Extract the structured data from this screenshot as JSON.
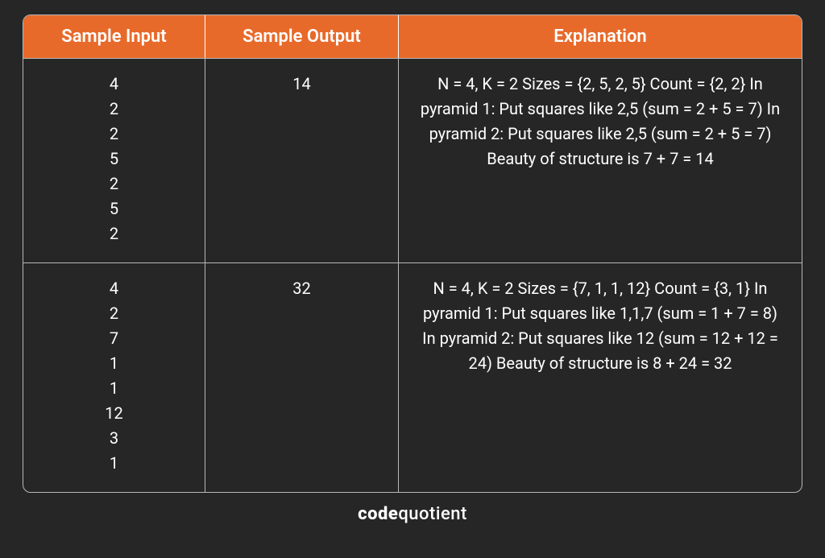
{
  "table": {
    "headers": {
      "input": "Sample Input",
      "output": "Sample Output",
      "explanation": "Explanation"
    },
    "rows": [
      {
        "input": "4\n2\n2\n5\n2\n5\n2",
        "output": "14",
        "explanation": "N = 4, K = 2 Sizes = {2, 5, 2, 5} Count = {2, 2} In pyramid 1: Put squares like 2,5 (sum = 2 + 5 = 7) In pyramid 2: Put squares like 2,5 (sum = 2 + 5 = 7) Beauty of structure is 7 + 7 = 14"
      },
      {
        "input": "4\n2\n7\n1\n1\n12\n3\n1",
        "output": "32",
        "explanation": "N = 4, K = 2 Sizes = {7, 1, 1, 12} Count = {3, 1} In pyramid 1: Put squares like 1,1,7 (sum = 1 + 7 = 8) In pyramid 2: Put squares like 12 (sum = 12 + 12 = 24) Beauty of structure is 8 + 24 = 32"
      }
    ]
  },
  "footer": {
    "brand_code": "code",
    "brand_quotient": "quotient"
  }
}
